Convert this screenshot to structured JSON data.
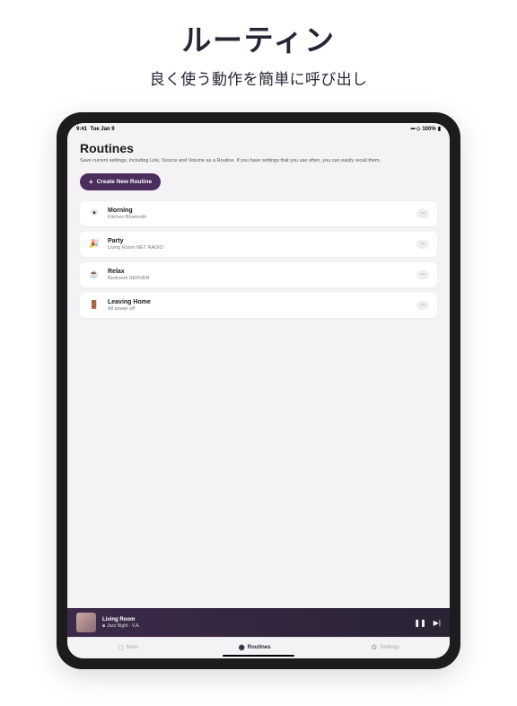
{
  "promo": {
    "title": "ルーティン",
    "subtitle": "良く使う動作を簡単に呼び出し"
  },
  "status": {
    "time": "9:41",
    "date": "Tue Jan 9",
    "battery": "100%"
  },
  "page": {
    "title": "Routines",
    "description": "Save current settings, including Link, Source and Volume as a Routine. If you have settings that you use often, you can easily recall them.",
    "create_label": "Create New Routine"
  },
  "routines": [
    {
      "icon": "☀",
      "name": "Morning",
      "room": "Kitchen",
      "source": "Bluetooth"
    },
    {
      "icon": "🎉",
      "name": "Party",
      "room": "Living Room",
      "source": "NET RADIO"
    },
    {
      "icon": "☕",
      "name": "Relax",
      "room": "Bedroom",
      "source": "SERVER"
    },
    {
      "icon": "🚪",
      "name": "Leaving Home",
      "room": "All power off",
      "source": ""
    }
  ],
  "player": {
    "room": "Living Room",
    "track": "Jazz Night - V.A."
  },
  "tabs": {
    "main": "Main",
    "routines": "Routines",
    "settings": "Settings"
  }
}
